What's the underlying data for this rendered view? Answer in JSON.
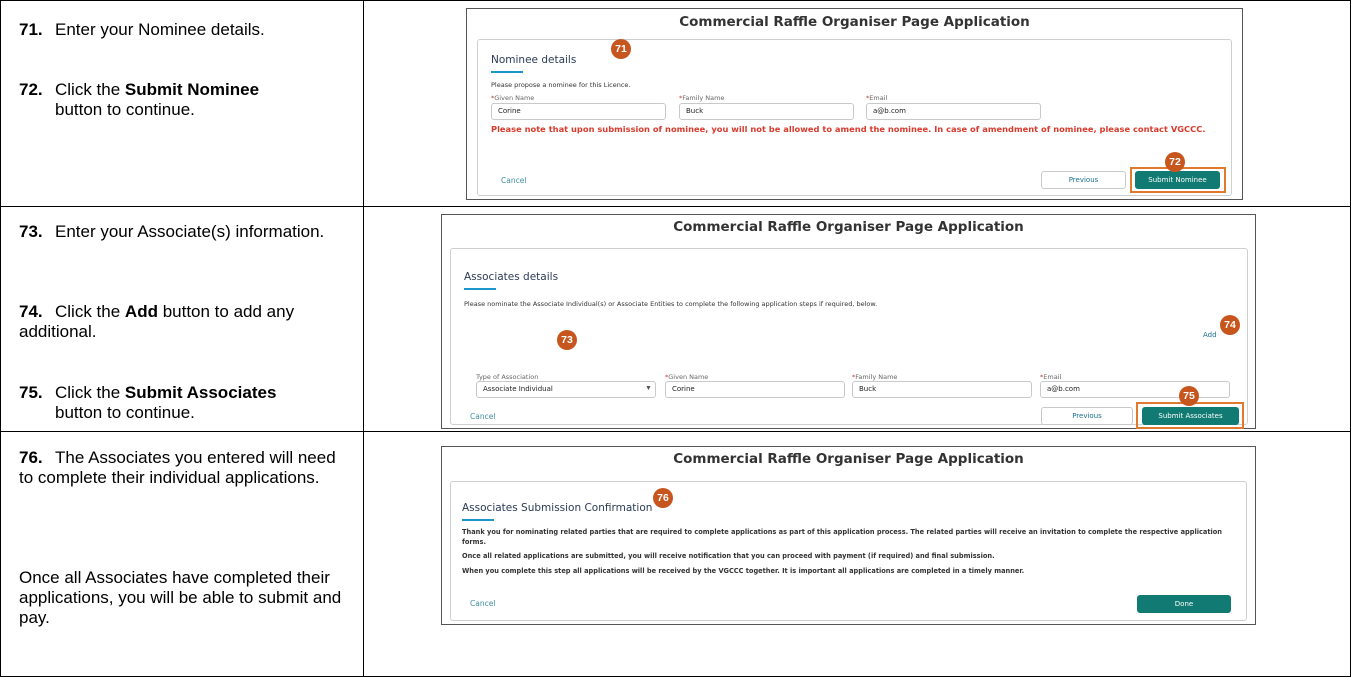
{
  "rows": [
    {
      "steps": [
        {
          "num": "71.",
          "pre": "Enter your Nominee details.",
          "bold": "",
          "post": ""
        },
        {
          "num": "72.",
          "pre": "Click the ",
          "bold": "Submit Nominee",
          "post": "button to continue."
        }
      ],
      "shot": {
        "title": "Commercial Raffle Organiser Page Application",
        "card_heading": "Nominee details",
        "intro": "Please propose a nominee for this Licence.",
        "fields": [
          {
            "label": "Given Name",
            "value": "Corine"
          },
          {
            "label": "Family Name",
            "value": "Buck"
          },
          {
            "label": "Email",
            "value": "a@b.com"
          }
        ],
        "warning": "Please note that upon submission of nominee, you will not be allowed to amend the nominee. In case of amendment of nominee, please contact VGCCC.",
        "cancel": "Cancel",
        "previous": "Previous",
        "submit": "Submit Nominee",
        "markers": [
          "71",
          "72"
        ]
      }
    },
    {
      "steps": [
        {
          "num": "73.",
          "pre": "Enter your Associate(s) information.",
          "bold": "",
          "post": ""
        },
        {
          "num": "74.",
          "pre": "Click the ",
          "bold": "Add",
          "post": " button to add any additional."
        },
        {
          "num": "75.",
          "pre": "Click the ",
          "bold": "Submit Associates",
          "post": "button to continue."
        }
      ],
      "shot": {
        "title": "Commercial Raffle Organiser Page Application",
        "card_heading": "Associates details",
        "intro": "Please nominate the Associate Individual(s) or Associate Entities to complete the following application steps if required, below.",
        "add": "Add",
        "type_label": "Type of Association",
        "type_value": "Associate Individual",
        "fields": [
          {
            "label": "Given Name",
            "value": "Corine"
          },
          {
            "label": "Family Name",
            "value": "Buck"
          },
          {
            "label": "Email",
            "value": "a@b.com"
          }
        ],
        "cancel": "Cancel",
        "previous": "Previous",
        "submit": "Submit Associates",
        "markers": [
          "73",
          "74",
          "75"
        ]
      }
    },
    {
      "steps": [
        {
          "num": "76.",
          "pre": "The Associates you entered will need to complete their individual applications.",
          "bold": "",
          "post": ""
        }
      ],
      "extra": "Once all Associates have completed their applications, you will be able to submit and pay.",
      "shot": {
        "title": "Commercial Raffle Organiser Page Application",
        "card_heading": "Associates Submission Confirmation",
        "paragraphs": [
          "Thank you for nominating related parties that are required to complete applications as part of this application process. The related parties will receive an invitation to complete the respective application forms.",
          "Once all related applications are submitted, you will receive notification that you can proceed with payment (if required) and final submission.",
          "When you complete this step all applications will be received by the VGCCC together. It is important all applications are completed in a timely manner."
        ],
        "cancel": "Cancel",
        "done": "Done",
        "markers": [
          "76"
        ]
      }
    }
  ]
}
